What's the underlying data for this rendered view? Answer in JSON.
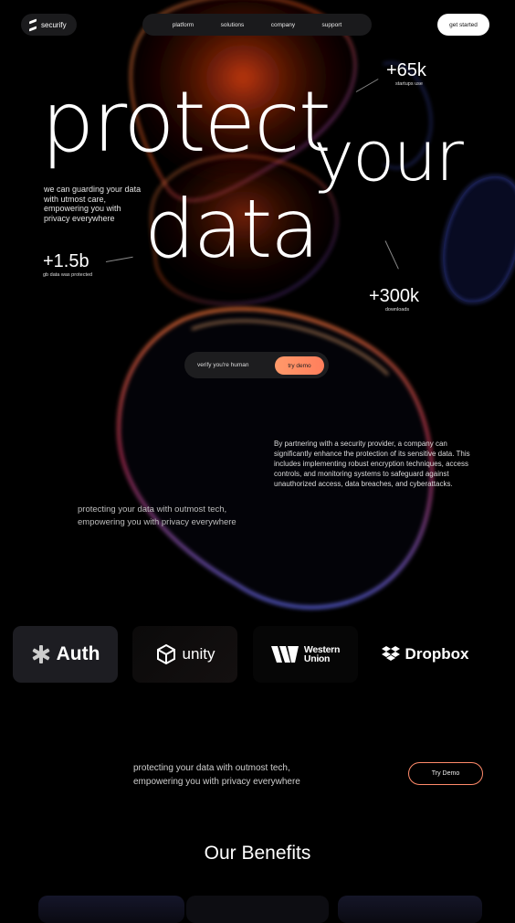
{
  "nav": {
    "brand": "securify",
    "links": [
      "platform",
      "solutions",
      "company",
      "support"
    ],
    "cta": "get started"
  },
  "hero": {
    "word1": "protect",
    "word2": "your",
    "word3": "data",
    "intro": "we can guarding your data with utmost care, empowering you with privacy everywhere",
    "stats": [
      {
        "value": "+65k",
        "caption": "startups use"
      },
      {
        "value": "+1.5b",
        "caption": "gb data was protected"
      },
      {
        "value": "+300k",
        "caption": "downloads"
      }
    ]
  },
  "verify": {
    "label": "verify you're human",
    "button": "try demo"
  },
  "paragraph": "By partnering with a security provider, a company can significantly enhance the protection of its sensitive data. This includes implementing robust encryption techniques, access controls, and monitoring systems to safeguard against unauthorized access, data breaches, and cyberattacks.",
  "tagline": "protecting your data with outmost tech, empowering you with privacy everywhere",
  "partners": [
    {
      "name": "Auth",
      "icon": "auth-asterisk-icon"
    },
    {
      "name": "unity",
      "icon": "unity-cube-icon"
    },
    {
      "name": "Western Union",
      "line1": "Western",
      "line2": "Union",
      "icon": "western-union-icon"
    },
    {
      "name": "Dropbox",
      "icon": "dropbox-icon"
    }
  ],
  "cta_band": {
    "tagline": "protecting your data with outmost tech, empowering you with privacy everywhere",
    "button": "Try Demo"
  },
  "benefits": {
    "title": "Our Benefits"
  },
  "colors": {
    "accent": "#ff8a5c",
    "blue": "#5a6cff",
    "bg": "#000000"
  }
}
